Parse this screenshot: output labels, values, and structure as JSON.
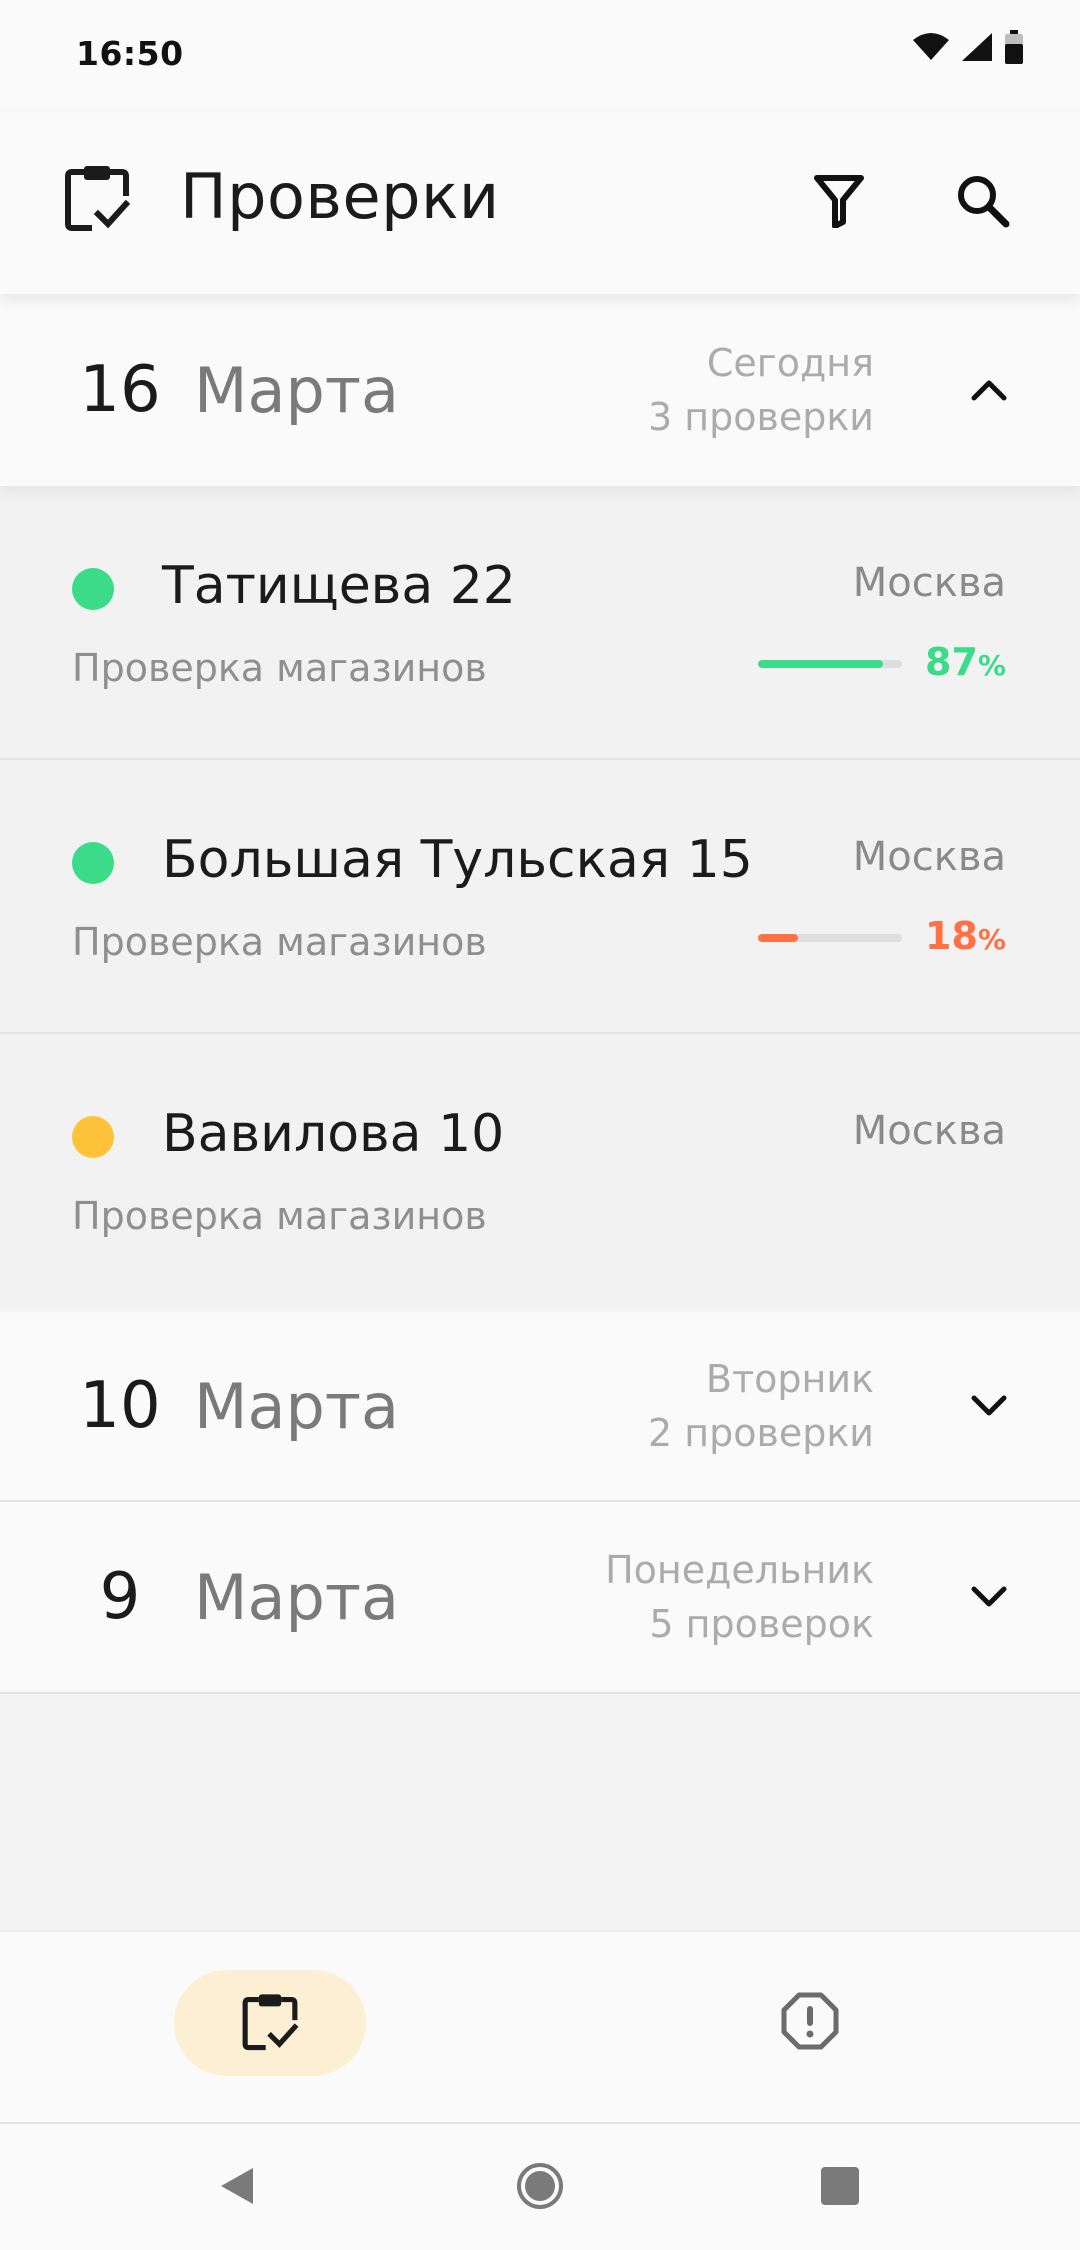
{
  "status_bar": {
    "time": "16:50"
  },
  "app_bar": {
    "title": "Проверки",
    "logo_icon": "clipboard-check-icon",
    "actions": [
      {
        "name": "filter",
        "icon": "filter-icon"
      },
      {
        "name": "search",
        "icon": "search-icon"
      }
    ]
  },
  "groups": [
    {
      "day": "16",
      "month": "Марта",
      "weekday": "Сегодня",
      "count": "3 проверки",
      "expanded": true,
      "items": [
        {
          "address": "Татищева 22",
          "city": "Москва",
          "type": "Проверка магазинов",
          "status_color": "#3bdb8a",
          "progress_value": "87",
          "progress_unit": "%",
          "progress_fraction": 0.87,
          "progress_color": "#3bdb8a"
        },
        {
          "address": "Большая Тульская 15",
          "city": "Москва",
          "type": "Проверка магазинов",
          "status_color": "#3bdb8a",
          "progress_value": "18",
          "progress_unit": "%",
          "progress_fraction": 0.18,
          "progress_color": "#ff7043"
        },
        {
          "address": "Вавилова 10",
          "city": "Москва",
          "type": "Проверка магазинов",
          "status_color": "#ffc23a"
        }
      ]
    },
    {
      "day": "10",
      "month": "Марта",
      "weekday": "Вторник",
      "count": "2 проверки",
      "expanded": false
    },
    {
      "day": "9",
      "month": "Марта",
      "weekday": "Понедельник",
      "count": "5 проверок",
      "expanded": false
    }
  ],
  "bottom_nav": [
    {
      "name": "checks",
      "icon": "clipboard-check-icon",
      "active": true
    },
    {
      "name": "issues",
      "icon": "alert-octagon-icon",
      "active": false
    }
  ],
  "colors": {
    "accent_active_nav": "#fdefd3",
    "success": "#3bdb8a",
    "danger": "#ff7043",
    "warning": "#ffc23a"
  }
}
